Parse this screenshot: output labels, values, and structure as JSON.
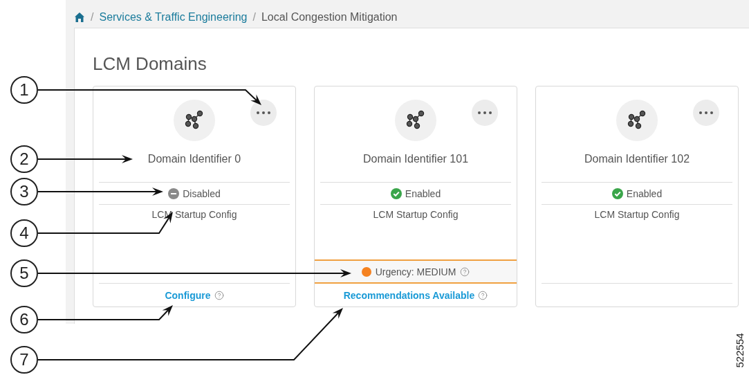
{
  "breadcrumb": [
    {
      "separator": "/",
      "label": "Services & Traffic Engineering",
      "kind": "link"
    },
    {
      "separator": "/",
      "label": "Local Congestion Mitigation",
      "kind": "current"
    }
  ],
  "page_title": "LCM Domains",
  "domains": [
    {
      "name": "Domain Identifier 0",
      "status": {
        "kind": "disabled",
        "label": "Disabled"
      },
      "config": "LCM Startup Config",
      "footer_link": "Configure"
    },
    {
      "name": "Domain Identifier 101",
      "status": {
        "kind": "enabled",
        "label": "Enabled"
      },
      "config": "LCM Startup Config",
      "urgency": "Urgency: MEDIUM",
      "footer_link": "Recommendations Available"
    },
    {
      "name": "Domain Identifier 102",
      "status": {
        "kind": "enabled",
        "label": "Enabled"
      },
      "config": "LCM Startup Config"
    }
  ],
  "callouts": [
    "1",
    "2",
    "3",
    "4",
    "5",
    "6",
    "7"
  ],
  "figure_number": "522554"
}
